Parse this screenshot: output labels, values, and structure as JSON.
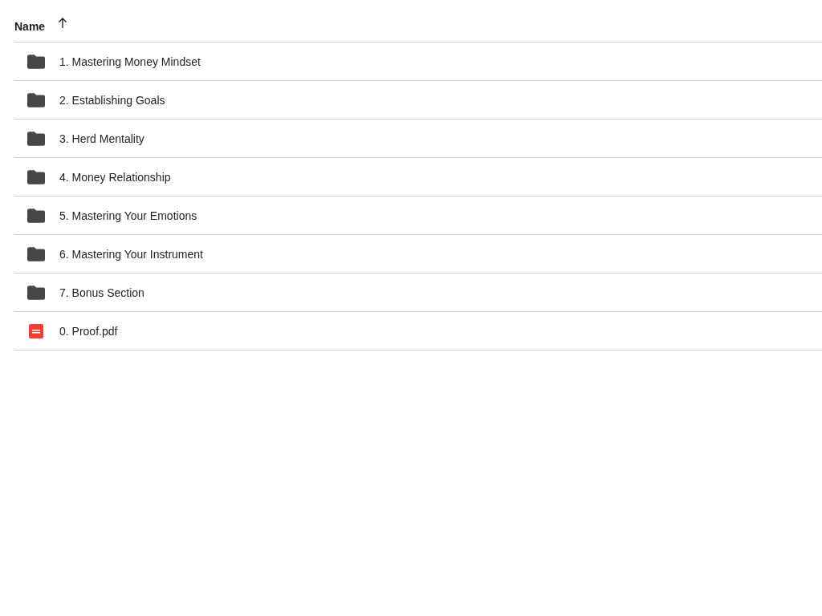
{
  "header": {
    "label": "Name",
    "ascending": true
  },
  "files": [
    {
      "kind": "folder",
      "name": "1. Mastering Money Mindset"
    },
    {
      "kind": "folder",
      "name": "2. Establishing Goals"
    },
    {
      "kind": "folder",
      "name": "3. Herd Mentality"
    },
    {
      "kind": "folder",
      "name": "4. Money Relationship"
    },
    {
      "kind": "folder",
      "name": "5. Mastering Your Emotions"
    },
    {
      "kind": "folder",
      "name": "6. Mastering Your Instrument"
    },
    {
      "kind": "folder",
      "name": "7. Bonus Section"
    },
    {
      "kind": "pdf",
      "name": "0. Proof.pdf"
    }
  ]
}
